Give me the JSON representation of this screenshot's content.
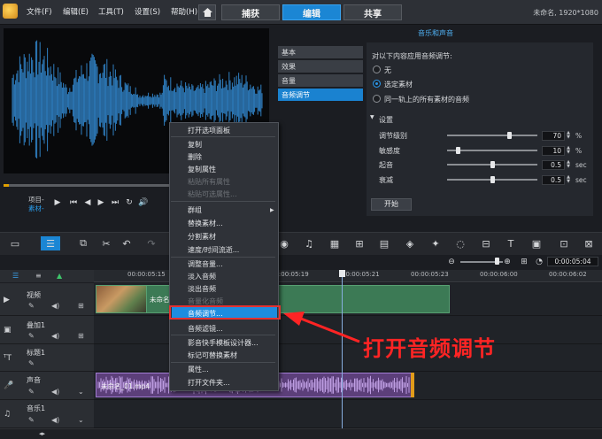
{
  "menu": {
    "items": [
      "文件(F)",
      "编辑(E)",
      "工具(T)",
      "设置(S)",
      "帮助(H)"
    ],
    "tabs": [
      "捕获",
      "编辑",
      "共享"
    ],
    "active_tab": "编辑",
    "project_title": "未命名, 1920*1080"
  },
  "player": {
    "mode_project": "项目-",
    "mode_clip": "素材-"
  },
  "options": {
    "header": "音乐和声音",
    "tabs": [
      "基本",
      "效果",
      "音量",
      "音频调节"
    ],
    "active_tab": "音频调节",
    "apply_label": "对以下内容应用音频调节:",
    "radios": [
      "无",
      "选定素材",
      "同一轨上的所有素材的音频"
    ],
    "selected_radio": "选定素材",
    "settings_label": "设置",
    "sliders": [
      {
        "label": "调节级别",
        "value": "70",
        "unit": "%",
        "level": 0.7
      },
      {
        "label": "敏感度",
        "value": "10",
        "unit": "%",
        "level": 0.1
      },
      {
        "label": "起音",
        "value": "0.5",
        "unit": "sec",
        "level": 0.5
      },
      {
        "label": "衰减",
        "value": "0.5",
        "unit": "sec",
        "level": 0.5
      }
    ],
    "start_button": "开始"
  },
  "timeline": {
    "timecode": "0:00:05:04",
    "ruler": [
      "00:00:05:15",
      "00:00:05:19",
      "00:00:05:21",
      "00:00:05:23",
      "00:00:06:00",
      "00:00:06:02"
    ],
    "tracks": [
      "视频",
      "叠加1",
      "标题1",
      "声音",
      "音乐1"
    ],
    "video_clip_label": "未命名",
    "audio_clip_label": "未命名_01.mp4"
  },
  "context_menu": {
    "items": [
      {
        "label": "打开选项面板",
        "disabled": false
      },
      {
        "label": "复制",
        "disabled": false
      },
      {
        "label": "删除",
        "disabled": false
      },
      {
        "label": "复制属性",
        "disabled": false
      },
      {
        "label": "粘贴所有属性",
        "disabled": true
      },
      {
        "label": "粘贴可选属性...",
        "disabled": true
      },
      {
        "label": "群组",
        "disabled": false
      },
      {
        "label": "替换素材...",
        "disabled": false
      },
      {
        "label": "分割素材",
        "disabled": false
      },
      {
        "label": "速度/时间流逝...",
        "disabled": false
      },
      {
        "label": "调整音量...",
        "disabled": false
      },
      {
        "label": "淡入音频",
        "disabled": false
      },
      {
        "label": "淡出音频",
        "disabled": false
      },
      {
        "label": "音量化音频",
        "disabled": true
      },
      {
        "label": "音频调节...",
        "disabled": false
      },
      {
        "label": "音频滤镜...",
        "disabled": false
      },
      {
        "label": "影音快手模板设计器...",
        "disabled": false
      },
      {
        "label": "标记可替换素材",
        "disabled": false
      },
      {
        "label": "属性...",
        "disabled": false
      },
      {
        "label": "打开文件夹...",
        "disabled": false
      }
    ],
    "highlighted": "音频调节..."
  },
  "annotation": {
    "text": "打开音频调节",
    "color": "#ff2424"
  },
  "colors": {
    "accent": "#1b86d4",
    "waveform": "#2f7fc0",
    "video_clip": "#3c7a55",
    "audio_clip": "#5c3f7a"
  }
}
